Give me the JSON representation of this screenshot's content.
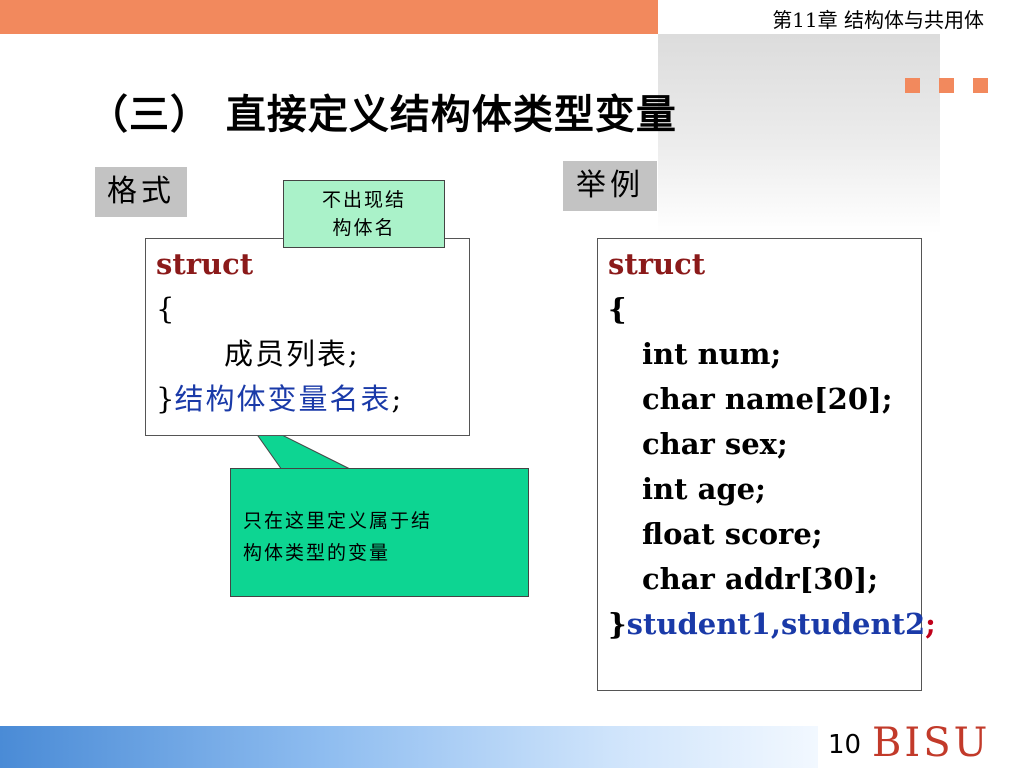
{
  "header": {
    "chapter": "第11章  结构体与共用体"
  },
  "title": "（三） 直接定义结构体类型变量",
  "labels": {
    "format": "格式",
    "example": "举例"
  },
  "format_code": {
    "kw": "struct",
    "open": "{",
    "members": "成员列表",
    "members_end": ";",
    "close": "}",
    "varlist": "结构体变量名表",
    "end": ";"
  },
  "callouts": {
    "top": {
      "line1": "不出现结",
      "line2": "构体名"
    },
    "bottom": {
      "line1": "只在这里定义属于结",
      "line2": "构体类型的变量"
    }
  },
  "example_code": {
    "kw": "struct",
    "open": "{",
    "lines": [
      "int num;",
      "char name[20];",
      "char sex;",
      "int age;",
      "float  score;",
      "char addr[30];"
    ],
    "close": "}",
    "vars": "student1,student2",
    "end": ";"
  },
  "footer": {
    "page": "10",
    "brand": "BISU"
  },
  "colors": {
    "accent": "#f2895d",
    "keyword": "#8b1a1a",
    "variable": "#1a3aa8",
    "callout_light": "#aaf2c9",
    "callout_dark": "#0dd592"
  }
}
